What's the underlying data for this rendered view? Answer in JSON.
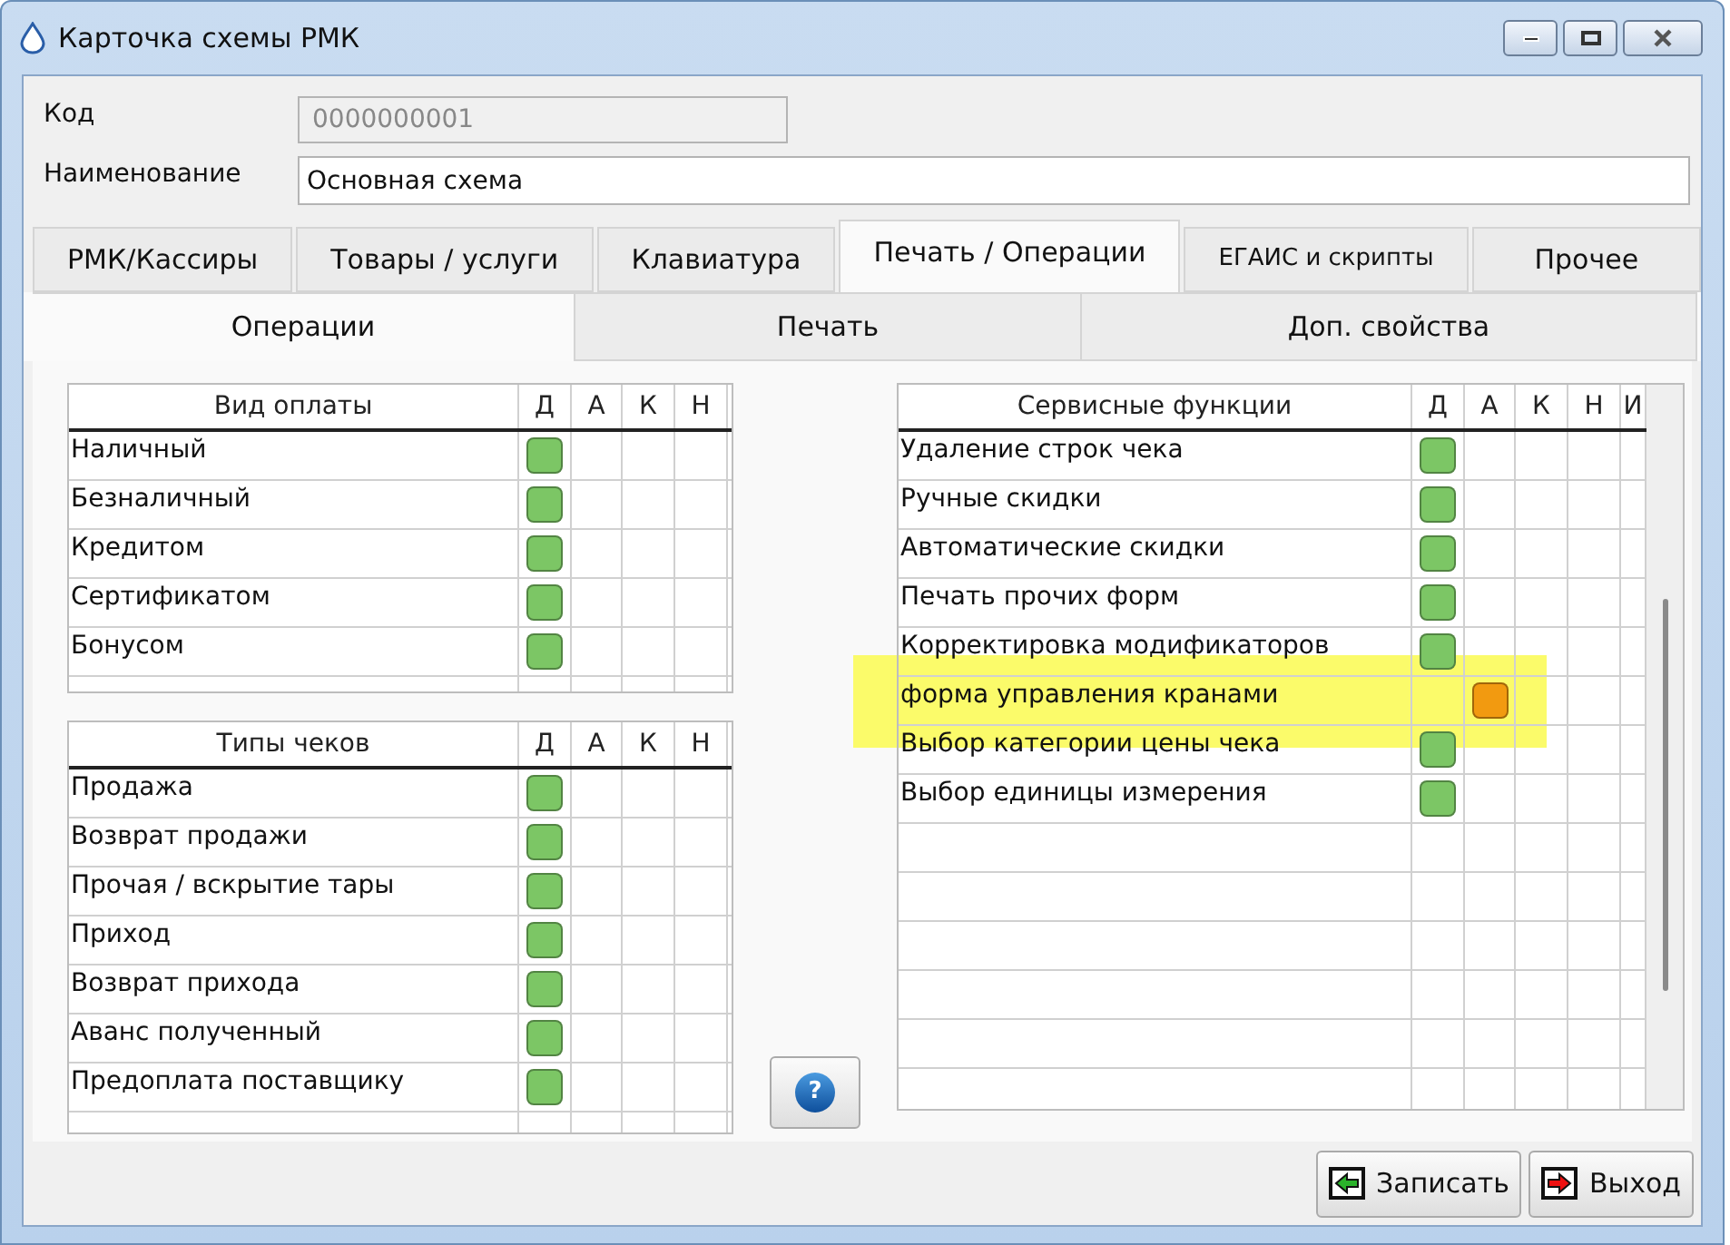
{
  "window": {
    "title": "Карточка схемы РМК"
  },
  "fields": [
    {
      "label": "Код",
      "value": "0000000001",
      "disabled": true
    },
    {
      "label": "Наименование",
      "value": "Основная схема",
      "disabled": false
    }
  ],
  "tabs": [
    {
      "label": "РМК/Кассиры",
      "selected": false
    },
    {
      "label": "Товары / услуги",
      "selected": false
    },
    {
      "label": "Клавиатура",
      "selected": false
    },
    {
      "label": "Печать / Операции",
      "selected": true
    },
    {
      "label": "ЕГАИС и скрипты",
      "selected": false
    },
    {
      "label": "Прочее",
      "selected": false
    }
  ],
  "subtabs": [
    {
      "label": "Операции",
      "selected": true
    },
    {
      "label": "Печать",
      "selected": false
    },
    {
      "label": "Доп. свойства",
      "selected": false
    }
  ],
  "tables": [
    {
      "title": "Вид оплаты",
      "columns": [
        "Д",
        "А",
        "К",
        "Н"
      ],
      "rows": [
        {
          "label": "Наличный",
          "cells": [
            {
              "checked": true,
              "color": "#7cc665"
            },
            {
              "checked": false
            },
            {
              "checked": false
            },
            {
              "checked": false
            }
          ]
        },
        {
          "label": "Безналичный",
          "cells": [
            {
              "checked": true,
              "color": "#7cc665"
            },
            {
              "checked": false
            },
            {
              "checked": false
            },
            {
              "checked": false
            }
          ]
        },
        {
          "label": "Кредитом",
          "cells": [
            {
              "checked": true,
              "color": "#7cc665"
            },
            {
              "checked": false
            },
            {
              "checked": false
            },
            {
              "checked": false
            }
          ]
        },
        {
          "label": "Сертификатом",
          "cells": [
            {
              "checked": true,
              "color": "#7cc665"
            },
            {
              "checked": false
            },
            {
              "checked": false
            },
            {
              "checked": false
            }
          ]
        },
        {
          "label": "Бонусом",
          "cells": [
            {
              "checked": true,
              "color": "#7cc665"
            },
            {
              "checked": false
            },
            {
              "checked": false
            },
            {
              "checked": false
            }
          ]
        }
      ]
    },
    {
      "title": "Типы чеков",
      "columns": [
        "Д",
        "А",
        "К",
        "Н"
      ],
      "rows": [
        {
          "label": "Продажа",
          "cells": [
            {
              "checked": true,
              "color": "#7cc665"
            },
            {
              "checked": false
            },
            {
              "checked": false
            },
            {
              "checked": false
            }
          ]
        },
        {
          "label": "Возврат продажи",
          "cells": [
            {
              "checked": true,
              "color": "#7cc665"
            },
            {
              "checked": false
            },
            {
              "checked": false
            },
            {
              "checked": false
            }
          ]
        },
        {
          "label": "Прочая / вскрытие тары",
          "cells": [
            {
              "checked": true,
              "color": "#7cc665"
            },
            {
              "checked": false
            },
            {
              "checked": false
            },
            {
              "checked": false
            }
          ]
        },
        {
          "label": "Приход",
          "cells": [
            {
              "checked": true,
              "color": "#7cc665"
            },
            {
              "checked": false
            },
            {
              "checked": false
            },
            {
              "checked": false
            }
          ]
        },
        {
          "label": "Возврат прихода",
          "cells": [
            {
              "checked": true,
              "color": "#7cc665"
            },
            {
              "checked": false
            },
            {
              "checked": false
            },
            {
              "checked": false
            }
          ]
        },
        {
          "label": "Аванс полученный",
          "cells": [
            {
              "checked": true,
              "color": "#7cc665"
            },
            {
              "checked": false
            },
            {
              "checked": false
            },
            {
              "checked": false
            }
          ]
        },
        {
          "label": "Предоплата поставщику",
          "cells": [
            {
              "checked": true,
              "color": "#7cc665"
            },
            {
              "checked": false
            },
            {
              "checked": false
            },
            {
              "checked": false
            }
          ]
        }
      ]
    },
    {
      "title": "Сервисные функции",
      "columns": [
        "Д",
        "А",
        "К",
        "Н",
        "И"
      ],
      "rows": [
        {
          "label": "Удаление строк чека",
          "highlighted": false,
          "cells": [
            {
              "checked": true,
              "color": "#7cc665"
            },
            {
              "checked": false
            },
            {
              "checked": false
            },
            {
              "checked": false
            },
            {
              "checked": false
            }
          ]
        },
        {
          "label": "Ручные скидки",
          "highlighted": false,
          "cells": [
            {
              "checked": true,
              "color": "#7cc665"
            },
            {
              "checked": false
            },
            {
              "checked": false
            },
            {
              "checked": false
            },
            {
              "checked": false
            }
          ]
        },
        {
          "label": "Автоматические скидки",
          "highlighted": false,
          "cells": [
            {
              "checked": true,
              "color": "#7cc665"
            },
            {
              "checked": false
            },
            {
              "checked": false
            },
            {
              "checked": false
            },
            {
              "checked": false
            }
          ]
        },
        {
          "label": "Печать прочих форм",
          "highlighted": false,
          "cells": [
            {
              "checked": true,
              "color": "#7cc665"
            },
            {
              "checked": false
            },
            {
              "checked": false
            },
            {
              "checked": false
            },
            {
              "checked": false
            }
          ]
        },
        {
          "label": "Корректировка модификаторов",
          "highlighted": false,
          "cells": [
            {
              "checked": true,
              "color": "#7cc665"
            },
            {
              "checked": false
            },
            {
              "checked": false
            },
            {
              "checked": false
            },
            {
              "checked": false
            }
          ]
        },
        {
          "label": "форма управления кранами",
          "highlighted": true,
          "cells": [
            {
              "checked": false
            },
            {
              "checked": true,
              "color": "#f29a10"
            },
            {
              "checked": false
            },
            {
              "checked": false
            },
            {
              "checked": false
            }
          ]
        },
        {
          "label": "Выбор категории цены чека",
          "highlighted": false,
          "cells": [
            {
              "checked": true,
              "color": "#7cc665"
            },
            {
              "checked": false
            },
            {
              "checked": false
            },
            {
              "checked": false
            },
            {
              "checked": false
            }
          ]
        },
        {
          "label": "Выбор единицы измерения",
          "highlighted": false,
          "cells": [
            {
              "checked": true,
              "color": "#7cc665"
            },
            {
              "checked": false
            },
            {
              "checked": false
            },
            {
              "checked": false
            },
            {
              "checked": false
            }
          ]
        }
      ]
    }
  ],
  "help_button": {
    "label": "?"
  },
  "buttons": [
    {
      "label": "Записать",
      "kind": "save"
    },
    {
      "label": "Выход",
      "kind": "exit"
    }
  ]
}
